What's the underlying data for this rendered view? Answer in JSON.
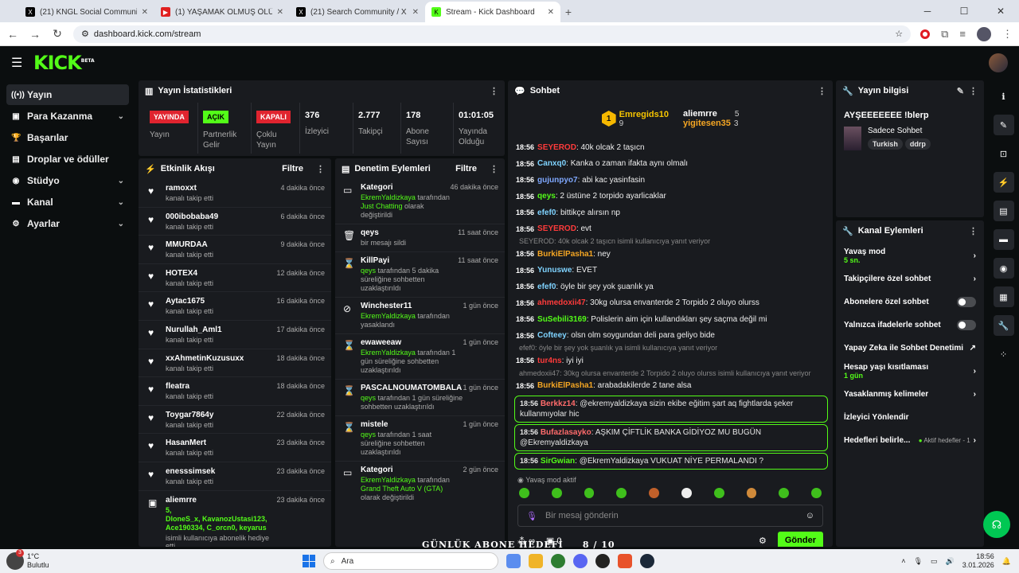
{
  "browser": {
    "tabs": [
      {
        "label": "(21) KNGL Social Community /",
        "icon": "x-logo-icon"
      },
      {
        "label": "(1) YAŞAMAK OLMUŞ ÖLÜMDİ",
        "icon": "youtube-icon"
      },
      {
        "label": "(21) Search Community / X",
        "icon": "x-logo-icon"
      },
      {
        "label": "Stream - Kick Dashboard",
        "icon": "kick-icon"
      }
    ],
    "url": "dashboard.kick.com/stream"
  },
  "brand": {
    "logo": "KICK",
    "beta": "BETA",
    "accent": "#53fc18"
  },
  "sidebar": {
    "items": [
      {
        "label": "Yayın",
        "icon": "broadcast-icon",
        "chev": ""
      },
      {
        "label": "Para Kazanma",
        "icon": "money-icon",
        "chev": "⌄"
      },
      {
        "label": "Başarılar",
        "icon": "trophy-icon",
        "chev": ""
      },
      {
        "label": "Droplar ve ödüller",
        "icon": "gift-icon",
        "chev": ""
      },
      {
        "label": "Stüdyo",
        "icon": "studio-icon",
        "chev": "⌄"
      },
      {
        "label": "Kanal",
        "icon": "channel-icon",
        "chev": "⌄"
      },
      {
        "label": "Ayarlar",
        "icon": "gear-icon",
        "chev": "⌄"
      }
    ]
  },
  "stats": {
    "title": "Yayın İstatistikleri",
    "cells": [
      {
        "badge": "YAYINDA",
        "label": "Yayın"
      },
      {
        "badge": "AÇIK",
        "label": "Partnerlik Gelir Programı"
      },
      {
        "badge": "KAPALI",
        "label": "Çoklu Yayın"
      },
      {
        "value": "376",
        "label": "İzleyici"
      },
      {
        "value": "2.777",
        "label": "Takipçi"
      },
      {
        "value": "178",
        "label": "Abone Sayısı"
      },
      {
        "value": "01:01:05",
        "label": "Yayında Olduğu Süre"
      }
    ]
  },
  "activity": {
    "title": "Etkinlik Akışı",
    "filter": "Filtre",
    "items": [
      {
        "name": "ramoxxt",
        "sub": "kanalı takip etti",
        "time": "4 dakika önce"
      },
      {
        "name": "000ibobaba49",
        "sub": "kanalı takip etti",
        "time": "6 dakika önce"
      },
      {
        "name": "MMURDAA",
        "sub": "kanalı takip etti",
        "time": "9 dakika önce"
      },
      {
        "name": "HOTEX4",
        "sub": "kanalı takip etti",
        "time": "12 dakika önce"
      },
      {
        "name": "Aytac1675",
        "sub": "kanalı takip etti",
        "time": "16 dakika önce"
      },
      {
        "name": "Nurullah_Aml1",
        "sub": "kanalı takip etti",
        "time": "17 dakika önce"
      },
      {
        "name": "xxAhmetinKuzusuxx",
        "sub": "kanalı takip etti",
        "time": "18 dakika önce"
      },
      {
        "name": "fleatra",
        "sub": "kanalı takip etti",
        "time": "18 dakika önce"
      },
      {
        "name": "Toygar7864y",
        "sub": "kanalı takip etti",
        "time": "22 dakika önce"
      },
      {
        "name": "HasanMert",
        "sub": "kanalı takip etti",
        "time": "23 dakika önce"
      },
      {
        "name": "enesssimsek",
        "sub": "kanalı takip etti",
        "time": "23 dakika önce"
      }
    ],
    "gift": {
      "name": "aliemrre",
      "time": "23 dakika önce",
      "count": "5,",
      "recipients": "DloneS_x, KavanozUstasi123, Ace190334, C_orcn0, keyarus",
      "sub": "isimli kullanıcıya abonelik hediye etti."
    }
  },
  "moderation": {
    "title": "Denetim Eylemleri",
    "filter": "Filtre",
    "items": [
      {
        "icon": "category-icon",
        "name": "Kategori",
        "time": "46 dakika önce",
        "hl": "EkremYaldizkaya",
        "mid": " tarafından ",
        "hl2": "Just Chatting",
        "tail": " olarak değiştirildi"
      },
      {
        "icon": "trash-icon",
        "name": "qeys",
        "time": "11 saat önce",
        "hl": "",
        "mid": "",
        "hl2": "",
        "tail": "bir mesajı sildi"
      },
      {
        "icon": "hourglass-icon",
        "name": "KillPayi",
        "time": "11 saat önce",
        "hl": "qeys",
        "mid": "",
        "hl2": "",
        "tail": " tarafından 5 dakika süreliğine sohbetten uzaklaştırıldı"
      },
      {
        "icon": "ban-icon",
        "name": "Winchester11",
        "time": "1 gün önce",
        "hl": "EkremYaldizkaya",
        "mid": "",
        "hl2": "",
        "tail": " tarafından yasaklandı"
      },
      {
        "icon": "hourglass-icon",
        "name": "ewaweeaw",
        "time": "1 gün önce",
        "hl": "EkremYaldizkaya",
        "mid": "",
        "hl2": "",
        "tail": " tarafından 1 gün süreliğine sohbetten uzaklaştırıldı"
      },
      {
        "icon": "hourglass-icon",
        "name": "PASCALNOUMATOMBALA",
        "time": "1 gün önce",
        "hl": "qeys",
        "mid": "",
        "hl2": "",
        "tail": " tarafından 1 gün süreliğine sohbetten uzaklaştırıldı"
      },
      {
        "icon": "hourglass-icon",
        "name": "mistele",
        "time": "1 gün önce",
        "hl": "qeys",
        "mid": "",
        "hl2": "",
        "tail": " tarafından 1 saat süreliğine sohbetten uzaklaştırıldı"
      },
      {
        "icon": "category-icon",
        "name": "Kategori",
        "time": "2 gün önce",
        "hl": "EkremYaldizkaya",
        "mid": " tarafından ",
        "hl2": "Grand Theft Auto V (GTA)",
        "tail": " olarak değiştirildi"
      }
    ]
  },
  "chat": {
    "title": "Sohbet",
    "top": [
      {
        "rank": "1",
        "name": "Emregids10",
        "count": "9"
      },
      {
        "name": "aliemrre",
        "count": "5"
      },
      {
        "name": "yigitesen35",
        "count": "3"
      }
    ],
    "lines": [
      {
        "reply": "",
        "ts": "18:56",
        "user": "SEYEROD",
        "color": "#ff3b3b",
        "msg": ": 40k olcak 2 taşıcn"
      },
      {
        "reply": "",
        "ts": "18:56",
        "user": "Canxq0",
        "color": "#7fd3ff",
        "msg": ": Kanka o zaman ifakta aynı olmalı"
      },
      {
        "reply": "",
        "ts": "18:56",
        "user": "gujunpyo7",
        "color": "#7fa8ff",
        "msg": ": abi kac yasinfasin"
      },
      {
        "reply": "",
        "ts": "18:56",
        "user": "qeys",
        "color": "#53fc18",
        "msg": ": 2 üstüne 2 torpido ayarlicaklar"
      },
      {
        "reply": "",
        "ts": "18:56",
        "user": "efef0",
        "color": "#7fd3ff",
        "msg": ": bittikçe alırsın np"
      },
      {
        "reply": "",
        "ts": "18:56",
        "user": "SEYEROD",
        "color": "#ff3b3b",
        "msg": ": evt"
      },
      {
        "reply": "SEYEROD: 40k olcak 2 taşıcn isimli kullanıcıya yanıt veriyor",
        "ts": "18:56",
        "user": "BurkiElPasha1",
        "color": "#f5a623",
        "msg": ": ney"
      },
      {
        "reply": "",
        "ts": "18:56",
        "user": "Yunuswe",
        "color": "#7fd3ff",
        "msg": ": EVET"
      },
      {
        "reply": "",
        "ts": "18:56",
        "user": "efef0",
        "color": "#7fd3ff",
        "msg": ": öyle bir şey yok şuanlık ya"
      },
      {
        "reply": "",
        "ts": "18:56",
        "user": "ahmedoxii47",
        "color": "#ff3b3b",
        "msg": ": 30kg olursa envanterde 2 Torpido 2 oluyo olurss"
      },
      {
        "reply": "",
        "ts": "18:56",
        "user": "SuSebili3169",
        "color": "#53fc18",
        "msg": ": Polislerin aim için kullandıkları şey saçma değil mi"
      },
      {
        "reply": "",
        "ts": "18:56",
        "user": "Cofteey",
        "color": "#7fd3ff",
        "msg": ": olsn olm soygundan deli para geliyo bide"
      },
      {
        "reply": "efef0: öyle bir şey yok şuanlık ya isimli kullanıcıya yanıt veriyor",
        "ts": "18:56",
        "user": "tur4ns",
        "color": "#ff3b3b",
        "msg": ": iyi iyi"
      },
      {
        "reply": "ahmedoxii47: 30kg olursa envanterde 2 Torpido 2 oluyo olurss isimli kullanıcıya yanıt veriyor",
        "ts": "18:56",
        "user": "BurkiElPasha1",
        "color": "#f5a623",
        "msg": ": arabadakilerde 2 tane alsa"
      }
    ],
    "highlighted": [
      {
        "ts": "18:56",
        "user": "Berkkz14",
        "color": "#ff6b6b",
        "msg": ": @ekremyaldizkaya sizin ekibe eğitim şart aq fightlarda şeker kullanmıyolar hic"
      },
      {
        "ts": "18:56",
        "user": "Bufazlasayko",
        "color": "#ff6b6b",
        "msg": ": AŞKIM ÇİFTLİK BANKA GİDİYOZ MU BUGÜN @Ekremyaldizkaya"
      },
      {
        "ts": "18:56",
        "user": "SirGwian",
        "color": "#53fc18",
        "msg": ": @EkremYaldizkaya VUKUAT NİYE PERMALANDI ?"
      }
    ],
    "slow_mode": "Yavaş mod aktif",
    "placeholder": "Bir mesaj gönderin",
    "infinity": "∞",
    "gift_count": "0",
    "send": "Gönder"
  },
  "stream_info": {
    "title": "Yayın bilgisi",
    "stream_title": "AYŞEEEEEEE !blerp",
    "category": "Sadece Sohbet",
    "tags": [
      "Turkish",
      "ddrp"
    ]
  },
  "channel_actions": {
    "title": "Kanal Eylemleri",
    "items": [
      {
        "label": "Yavaş mod",
        "sub": "5 sn.",
        "control": "chevron"
      },
      {
        "label": "Takipçilere özel sohbet",
        "sub": "",
        "control": "chevron"
      },
      {
        "label": "Abonelere özel sohbet",
        "sub": "",
        "control": "toggle"
      },
      {
        "label": "Yalnızca ifadelerle sohbet",
        "sub": "",
        "control": "toggle"
      },
      {
        "label": "Yapay Zeka ile Sohbet Denetimi",
        "sub": "",
        "control": "external"
      },
      {
        "label": "Hesap yaşı kısıtlaması",
        "sub": "1 gün",
        "control": "chevron"
      },
      {
        "label": "Yasaklanmış kelimeler",
        "sub": "",
        "control": "chevron"
      },
      {
        "label": "İzleyici Yönlendir",
        "sub": "",
        "control": ""
      },
      {
        "label": "Hedefleri belirle...",
        "sub": "",
        "control": "chevron",
        "extra": "Aktif hedefler - 1"
      }
    ]
  },
  "overlay": {
    "goal": "GÜNLÜK ABONE HEDEFİ",
    "progress": "8  / 10"
  },
  "taskbar": {
    "notif": "3",
    "temp": "1°C",
    "weather": "Bulutlu",
    "search": "Ara",
    "time": "18:56",
    "date": "3.01.2026"
  }
}
